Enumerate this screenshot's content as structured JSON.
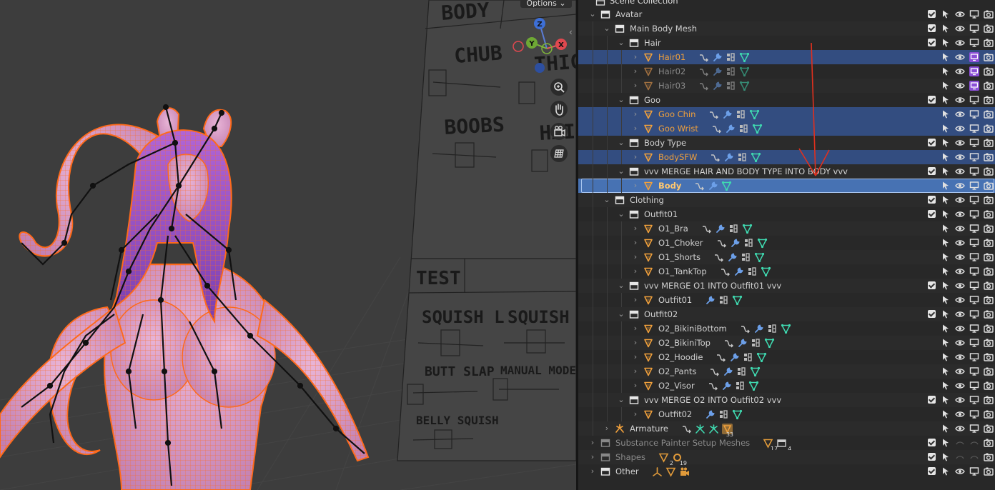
{
  "viewport": {
    "options_label": "Options",
    "gizmo": {
      "z": "Z",
      "y": "Y",
      "x": "X"
    },
    "tools": [
      "zoom-icon",
      "hand-icon",
      "camera-icon",
      "grid-icon"
    ],
    "board_labels": {
      "body": "BODY",
      "chub": "CHUB",
      "thigh": "THIGH",
      "boobs": "BOOBS",
      "hair": "HAIR",
      "test": "TEST",
      "squish_l": "SQUISH L",
      "squish_r": "SQUISH R",
      "butt_slap": "BUTT SLAP",
      "manual_mode": "MANUAL MODE",
      "belly_squish": "BELLY SQUISH"
    }
  },
  "outliner": {
    "header": "Scene Collection",
    "rows": [
      {
        "label": "Avatar",
        "type": "collection",
        "indent": 1,
        "disc": "open",
        "cb": true,
        "style": "normal",
        "restrict": "normal"
      },
      {
        "label": "Main Body Mesh",
        "type": "collection",
        "indent": 2,
        "disc": "open",
        "cb": true,
        "style": "normal",
        "restrict": "normal"
      },
      {
        "label": "Hair",
        "type": "collection",
        "indent": 3,
        "disc": "open",
        "cb": true,
        "style": "normal",
        "restrict": "normal"
      },
      {
        "label": "Hair01",
        "type": "mesh",
        "indent": 4,
        "disc": "closed",
        "cb": false,
        "style": "orange",
        "sel": true,
        "mods": [
          "link",
          "wrench",
          "modifier",
          "mesh"
        ],
        "restrict": "purple"
      },
      {
        "label": "Hair02",
        "type": "mesh",
        "indent": 4,
        "disc": "closed",
        "cb": false,
        "style": "dim",
        "dimicons": true,
        "mods": [
          "link",
          "wrench",
          "modifier",
          "mesh"
        ],
        "restrict": "purple"
      },
      {
        "label": "Hair03",
        "type": "mesh",
        "indent": 4,
        "disc": "closed",
        "cb": false,
        "style": "dim",
        "dimicons": true,
        "mods": [
          "link",
          "wrench",
          "modifier",
          "mesh"
        ],
        "restrict": "purple"
      },
      {
        "label": "Goo",
        "type": "collection",
        "indent": 3,
        "disc": "open",
        "cb": true,
        "style": "normal",
        "restrict": "normal"
      },
      {
        "label": "Goo Chin",
        "type": "mesh",
        "indent": 4,
        "disc": "closed",
        "cb": false,
        "style": "orange",
        "sel": true,
        "mods": [
          "link",
          "wrench",
          "modifier",
          "mesh"
        ],
        "restrict": "normal"
      },
      {
        "label": "Goo Wrist",
        "type": "mesh",
        "indent": 4,
        "disc": "closed",
        "cb": false,
        "style": "orange",
        "sel": true,
        "mods": [
          "link",
          "wrench",
          "modifier",
          "mesh"
        ],
        "restrict": "normal"
      },
      {
        "label": "Body Type",
        "type": "collection",
        "indent": 3,
        "disc": "open",
        "cb": true,
        "style": "normal",
        "restrict": "normal"
      },
      {
        "label": "BodySFW",
        "type": "mesh",
        "indent": 4,
        "disc": "closed",
        "cb": false,
        "style": "orange",
        "sel": true,
        "mods": [
          "link",
          "wrench",
          "modifier",
          "mesh"
        ],
        "restrict": "normal"
      },
      {
        "label": "vvv MERGE HAIR AND BODY TYPE INTO BODY vvv",
        "type": "collection",
        "indent": 3,
        "disc": "open",
        "cb": true,
        "style": "normal",
        "restrict": "normal"
      },
      {
        "label": "Body",
        "type": "mesh",
        "indent": 4,
        "disc": "closed",
        "cb": false,
        "style": "active",
        "active": true,
        "mods": [
          "link",
          "wrench",
          "mesh"
        ],
        "restrict": "normal"
      },
      {
        "label": "Clothing",
        "type": "collection",
        "indent": 2,
        "disc": "open",
        "cb": true,
        "style": "normal",
        "restrict": "normal"
      },
      {
        "label": "Outfit01",
        "type": "collection",
        "indent": 3,
        "disc": "open",
        "cb": true,
        "style": "normal",
        "restrict": "normal"
      },
      {
        "label": "O1_Bra",
        "type": "mesh",
        "indent": 4,
        "disc": "closed",
        "cb": false,
        "style": "normal",
        "mods": [
          "link",
          "wrench",
          "modifier",
          "mesh"
        ],
        "restrict": "normal"
      },
      {
        "label": "O1_Choker",
        "type": "mesh",
        "indent": 4,
        "disc": "closed",
        "cb": false,
        "style": "normal",
        "mods": [
          "link",
          "wrench",
          "modifier",
          "mesh"
        ],
        "restrict": "normal"
      },
      {
        "label": "O1_Shorts",
        "type": "mesh",
        "indent": 4,
        "disc": "closed",
        "cb": false,
        "style": "normal",
        "mods": [
          "link",
          "wrench",
          "modifier",
          "mesh"
        ],
        "restrict": "normal"
      },
      {
        "label": "O1_TankTop",
        "type": "mesh",
        "indent": 4,
        "disc": "closed",
        "cb": false,
        "style": "normal",
        "mods": [
          "link",
          "wrench",
          "modifier",
          "mesh"
        ],
        "restrict": "normal"
      },
      {
        "label": "vvv MERGE O1 INTO Outfit01 vvv",
        "type": "collection",
        "indent": 3,
        "disc": "open",
        "cb": true,
        "style": "normal",
        "restrict": "normal"
      },
      {
        "label": "Outfit01",
        "type": "mesh",
        "indent": 4,
        "disc": "closed",
        "cb": false,
        "style": "normal",
        "mods": [
          "wrench",
          "modifier",
          "mesh"
        ],
        "restrict": "normal"
      },
      {
        "label": "Outfit02",
        "type": "collection",
        "indent": 3,
        "disc": "open",
        "cb": true,
        "style": "normal",
        "restrict": "normal"
      },
      {
        "label": "O2_BikiniBottom",
        "type": "mesh",
        "indent": 4,
        "disc": "closed",
        "cb": false,
        "style": "normal",
        "mods": [
          "link",
          "wrench",
          "modifier",
          "mesh"
        ],
        "restrict": "normal"
      },
      {
        "label": "O2_BikiniTop",
        "type": "mesh",
        "indent": 4,
        "disc": "closed",
        "cb": false,
        "style": "normal",
        "mods": [
          "link",
          "wrench",
          "modifier",
          "mesh"
        ],
        "restrict": "normal"
      },
      {
        "label": "O2_Hoodie",
        "type": "mesh",
        "indent": 4,
        "disc": "closed",
        "cb": false,
        "style": "normal",
        "mods": [
          "link",
          "wrench",
          "modifier",
          "mesh"
        ],
        "restrict": "normal"
      },
      {
        "label": "O2_Pants",
        "type": "mesh",
        "indent": 4,
        "disc": "closed",
        "cb": false,
        "style": "normal",
        "mods": [
          "link",
          "wrench",
          "modifier",
          "mesh"
        ],
        "restrict": "normal"
      },
      {
        "label": "O2_Visor",
        "type": "mesh",
        "indent": 4,
        "disc": "closed",
        "cb": false,
        "style": "normal",
        "mods": [
          "link",
          "wrench",
          "modifier",
          "mesh"
        ],
        "restrict": "normal"
      },
      {
        "label": "vvv MERGE O2 INTO Outfit02 vvv",
        "type": "collection",
        "indent": 3,
        "disc": "open",
        "cb": true,
        "style": "normal",
        "restrict": "normal"
      },
      {
        "label": "Outfit02",
        "type": "mesh",
        "indent": 4,
        "disc": "closed",
        "cb": false,
        "style": "normal",
        "mods": [
          "wrench",
          "modifier",
          "mesh"
        ],
        "restrict": "normal"
      },
      {
        "label": "Armature",
        "type": "armature",
        "indent": 2,
        "disc": "closed",
        "cb": false,
        "style": "normal",
        "mods": [
          "link",
          "bone",
          "bone",
          "meshbadge"
        ],
        "badge": "33",
        "restrict": "normal"
      },
      {
        "label": "Substance Painter Setup Meshes",
        "type": "collection",
        "indent": 1,
        "disc": "closed",
        "cb": true,
        "style": "dim",
        "mods": [
          "tri",
          "coll"
        ],
        "counts": [
          "17",
          "4"
        ],
        "restrict": "excluded"
      },
      {
        "label": "Shapes",
        "type": "collection",
        "indent": 1,
        "disc": "closed",
        "cb": true,
        "style": "dim",
        "mods": [
          "tri",
          "ring"
        ],
        "counts": [
          "2",
          "19"
        ],
        "restrict": "excluded"
      },
      {
        "label": "Other",
        "type": "collection",
        "indent": 1,
        "disc": "closed",
        "cb": true,
        "style": "normal",
        "mods": [
          "empty",
          "tri",
          "camera"
        ],
        "restrict": "normal"
      }
    ]
  },
  "colors": {
    "orange": "#f0a03c",
    "selected_row": "#334d80",
    "active_row": "#4772b3",
    "modifier_blue": "#6c9fe8",
    "mesh_green": "#3fd9b0",
    "hide_purple": "#8b4fd6",
    "arrow_red": "#e0301e"
  }
}
